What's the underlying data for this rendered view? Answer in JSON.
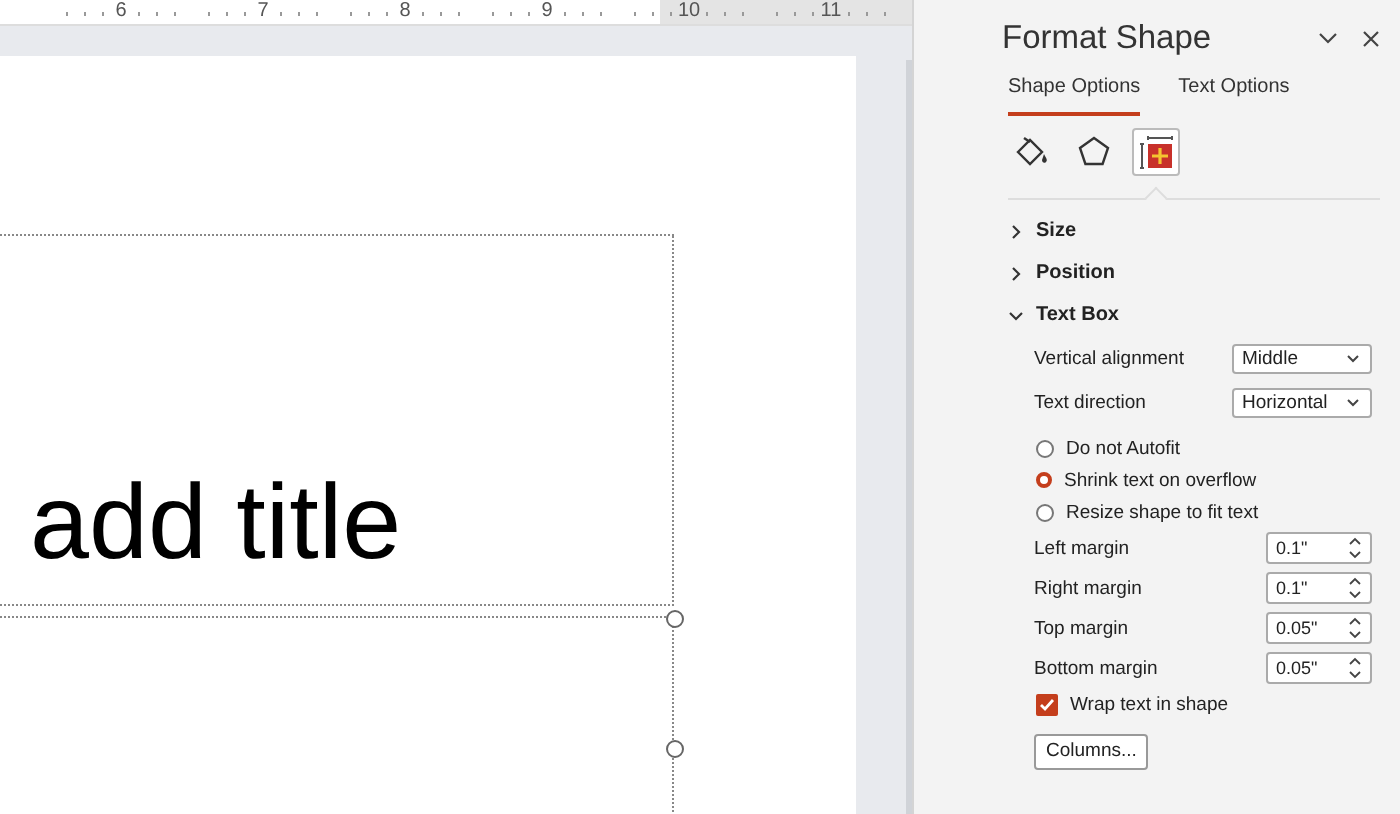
{
  "ruler": {
    "numbers": [
      "6",
      "7",
      "8",
      "9",
      "10",
      "11"
    ]
  },
  "slide": {
    "title_placeholder": "add title"
  },
  "panel": {
    "title": "Format Shape",
    "tabs": [
      {
        "label": "Shape Options",
        "selected": true
      },
      {
        "label": "Text Options",
        "selected": false
      }
    ],
    "icon_tabs": [
      {
        "kind": "fill",
        "selected": false
      },
      {
        "kind": "effects",
        "selected": false
      },
      {
        "kind": "size",
        "selected": true
      }
    ],
    "sections": [
      {
        "label": "Size",
        "expanded": false
      },
      {
        "label": "Position",
        "expanded": false
      },
      {
        "label": "Text Box",
        "expanded": true,
        "controls": [
          {
            "kind": "dropdown",
            "label": "Vertical alignment",
            "value": "Middle"
          },
          {
            "kind": "dropdown",
            "label": "Text direction",
            "value": "Horizontal"
          },
          {
            "kind": "radio",
            "label": "Do not Autofit",
            "selected": false
          },
          {
            "kind": "radio",
            "label": "Shrink text on overflow",
            "selected": true
          },
          {
            "kind": "radio",
            "label": "Resize shape to fit text",
            "selected": false
          },
          {
            "kind": "spinner",
            "label": "Left margin",
            "value": "0.1\""
          },
          {
            "kind": "spinner",
            "label": "Right margin",
            "value": "0.1\""
          },
          {
            "kind": "spinner",
            "label": "Top margin",
            "value": "0.05\""
          },
          {
            "kind": "spinner",
            "label": "Bottom margin",
            "value": "0.05\""
          },
          {
            "kind": "checkbox",
            "label": "Wrap text in shape",
            "checked": true
          },
          {
            "kind": "button",
            "label": "Columns..."
          }
        ]
      }
    ]
  }
}
